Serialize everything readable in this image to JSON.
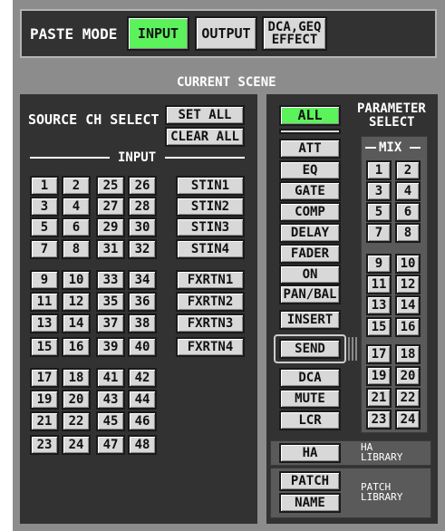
{
  "paste_mode": {
    "label": "PASTE MODE",
    "buttons": [
      {
        "label": "INPUT",
        "active": true
      },
      {
        "label": "OUTPUT",
        "active": false
      },
      {
        "label_line1": "DCA,GEQ",
        "label_line2": "EFFECT",
        "active": false
      }
    ]
  },
  "current_scene": {
    "label": "CURRENT SCENE"
  },
  "source": {
    "label": "SOURCE CH SELECT",
    "set_all": "SET ALL",
    "clear_all": "CLEAR ALL",
    "input_label": "INPUT",
    "channels": [
      "1",
      "2",
      "3",
      "4",
      "5",
      "6",
      "7",
      "8",
      "9",
      "10",
      "11",
      "12",
      "13",
      "14",
      "15",
      "16",
      "17",
      "18",
      "19",
      "20",
      "21",
      "22",
      "23",
      "24",
      "25",
      "26",
      "27",
      "28",
      "29",
      "30",
      "31",
      "32",
      "33",
      "34",
      "35",
      "36",
      "37",
      "38",
      "39",
      "40",
      "41",
      "42",
      "43",
      "44",
      "45",
      "46",
      "47",
      "48"
    ],
    "stin": [
      "STIN1",
      "STIN2",
      "STIN3",
      "STIN4"
    ],
    "fxrtn": [
      "FXRTN1",
      "FXRTN2",
      "FXRTN3",
      "FXRTN4"
    ]
  },
  "parameter": {
    "label_line1": "PARAMETER",
    "label_line2": "SELECT",
    "all": "ALL",
    "all_active": true,
    "group1": [
      "ATT",
      "EQ",
      "GATE",
      "COMP",
      "DELAY",
      "FADER",
      "ON",
      "PAN/BAL"
    ],
    "insert": "INSERT",
    "send": "SEND",
    "group2": [
      "DCA",
      "MUTE",
      "LCR"
    ],
    "mix_label": "MIX",
    "mix": [
      "1",
      "2",
      "3",
      "4",
      "5",
      "6",
      "7",
      "8",
      "9",
      "10",
      "11",
      "12",
      "13",
      "14",
      "15",
      "16",
      "17",
      "18",
      "19",
      "20",
      "21",
      "22",
      "23",
      "24"
    ]
  },
  "library": {
    "ha_button": "HA",
    "ha_line1": "HA",
    "ha_line2": "LIBRARY",
    "patch_button": "PATCH",
    "name_button": "NAME",
    "patch_line1": "PATCH",
    "patch_line2": "LIBRARY"
  },
  "colors": {
    "active_green": "#5cf25c",
    "panel_dark": "#323232",
    "frame_gray": "#8c8c8c",
    "button_gray": "#d8d8d8"
  }
}
